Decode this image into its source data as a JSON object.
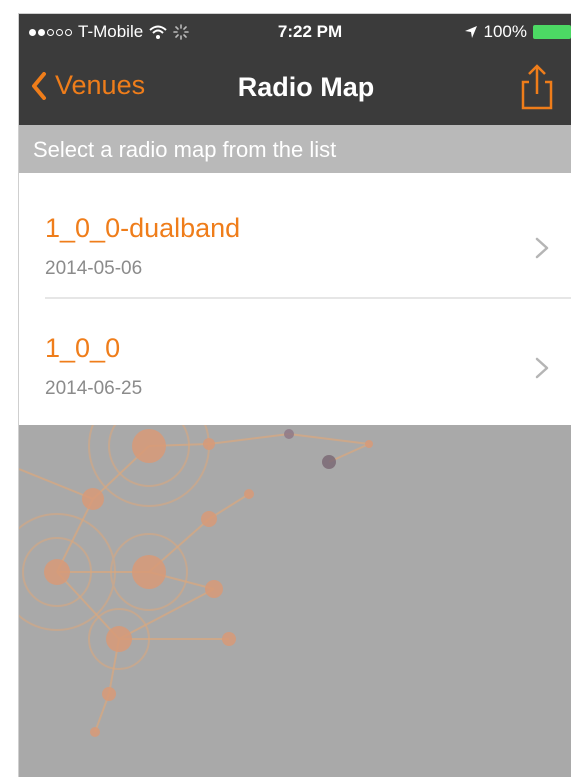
{
  "status_bar": {
    "carrier": "T-Mobile",
    "time": "7:22 PM",
    "battery": "100%"
  },
  "nav": {
    "back_label": "Venues",
    "title": "Radio Map"
  },
  "subheader": {
    "text": "Select a radio map from the list"
  },
  "list": {
    "items": [
      {
        "title": "1_0_0-dualband",
        "date": "2014-05-06"
      },
      {
        "title": "1_0_0",
        "date": "2014-06-25"
      }
    ]
  },
  "colors": {
    "accent": "#ef7d1a",
    "nav_background": "#3b3b3b",
    "content_background": "#a9a9a9",
    "battery": "#4cd964"
  },
  "icons": {
    "back": "chevron-left-icon",
    "share": "share-icon",
    "row": "chevron-right-icon"
  }
}
